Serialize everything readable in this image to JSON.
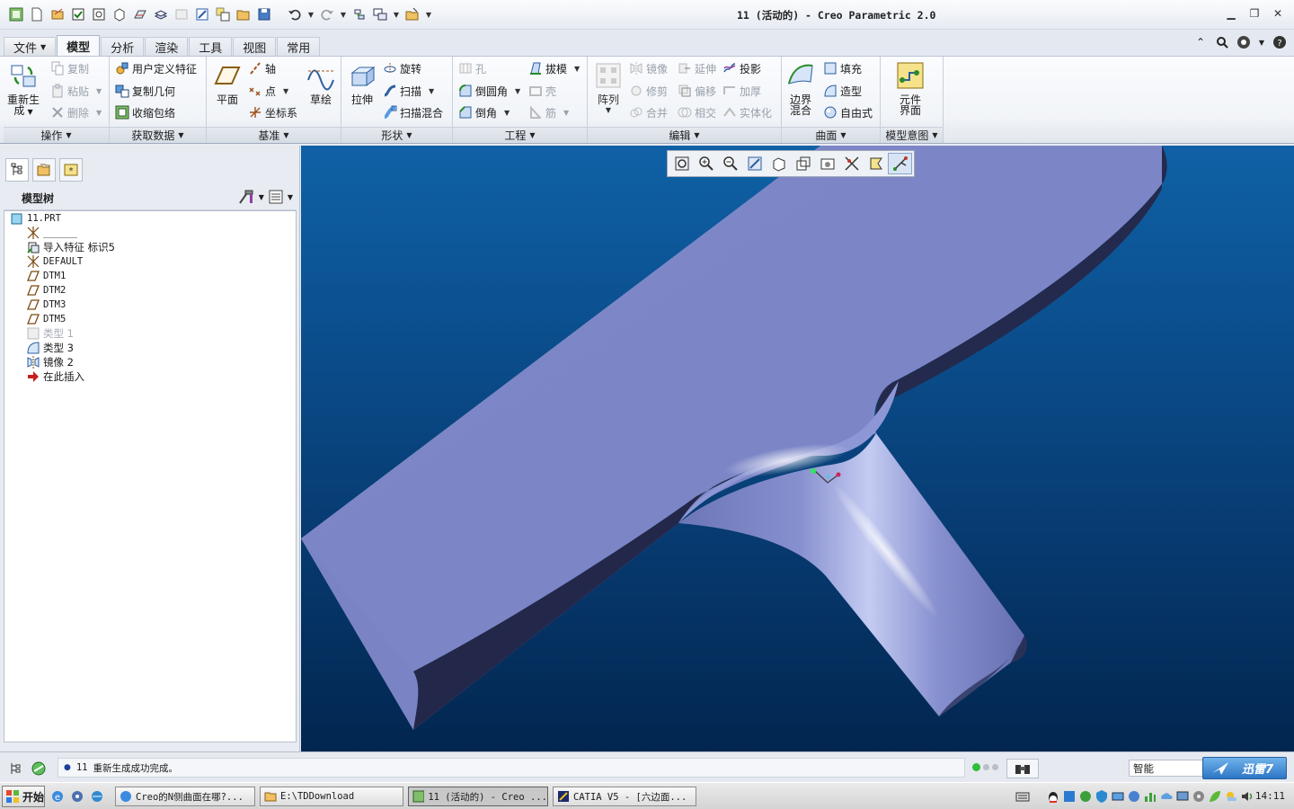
{
  "window": {
    "title": "11 (活动的) - Creo Parametric 2.0",
    "controls": [
      "minimize-icon",
      "restore-icon",
      "close-icon"
    ]
  },
  "tabs": [
    "文件",
    "模型",
    "分析",
    "渲染",
    "工具",
    "视图",
    "常用"
  ],
  "active_tab": "模型",
  "ribbon": {
    "operations": {
      "label": "操作",
      "regenerate_line1": "重新生",
      "regenerate_line2": "成",
      "copy": "复制",
      "paste": "粘贴",
      "delete": "删除"
    },
    "get_data": {
      "label": "获取数据",
      "udf": "用户定义特征",
      "copy_geom": "复制几何",
      "shrinkwrap": "收缩包络"
    },
    "datum": {
      "label": "基准",
      "plane": "平面",
      "axis": "轴",
      "point": "点",
      "csys": "坐标系",
      "sketch": "草绘"
    },
    "shapes": {
      "label": "形状",
      "extrude": "拉伸",
      "revolve": "旋转",
      "sweep": "扫描",
      "swept_blend": "扫描混合"
    },
    "engineering": {
      "label": "工程",
      "hole": "孔",
      "round": "倒圆角",
      "chamfer": "倒角",
      "draft": "拔模",
      "shell": "壳",
      "rib": "筋"
    },
    "editing": {
      "label": "编辑",
      "pattern": "阵列",
      "mirror": "镜像",
      "trim": "修剪",
      "merge": "合并",
      "extend": "延伸",
      "offset": "偏移",
      "intersect": "相交",
      "project": "投影",
      "thicken": "加厚",
      "solidify": "实体化"
    },
    "surfaces": {
      "label": "曲面",
      "boundary_line1": "边界",
      "boundary_line2": "混合",
      "fill": "填充",
      "style": "造型",
      "freestyle": "自由式"
    },
    "model_intent": {
      "label": "模型意图",
      "component_line1": "元件",
      "component_line2": "界面"
    }
  },
  "model_tree": {
    "title": "模型树",
    "items": [
      {
        "label": "11.PRT"
      },
      {
        "label": "______"
      },
      {
        "label": "导入特征 标识5"
      },
      {
        "label": "DEFAULT"
      },
      {
        "label": "DTM1"
      },
      {
        "label": "DTM2"
      },
      {
        "label": "DTM3"
      },
      {
        "label": "DTM5"
      },
      {
        "label": "类型 1"
      },
      {
        "label": "类型 3"
      },
      {
        "label": "镜像 2"
      },
      {
        "label": "在此插入"
      }
    ]
  },
  "status": {
    "message_num": "11",
    "message_text": "重新生成成功完成。",
    "filter": "智能",
    "xunlei_label": "迅雷7"
  },
  "taskbar": {
    "start": "开始",
    "tasks": [
      "Creo的N侧曲面在哪?...",
      "E:\\TDDownload",
      "11 (活动的) - Creo ...",
      "CATIA V5 - [六边面..."
    ],
    "clock": "14:11"
  },
  "colors": {
    "viewport_top": "#0f61a6",
    "viewport_bottom": "#02264f",
    "model_surface": "#7c86c7"
  }
}
